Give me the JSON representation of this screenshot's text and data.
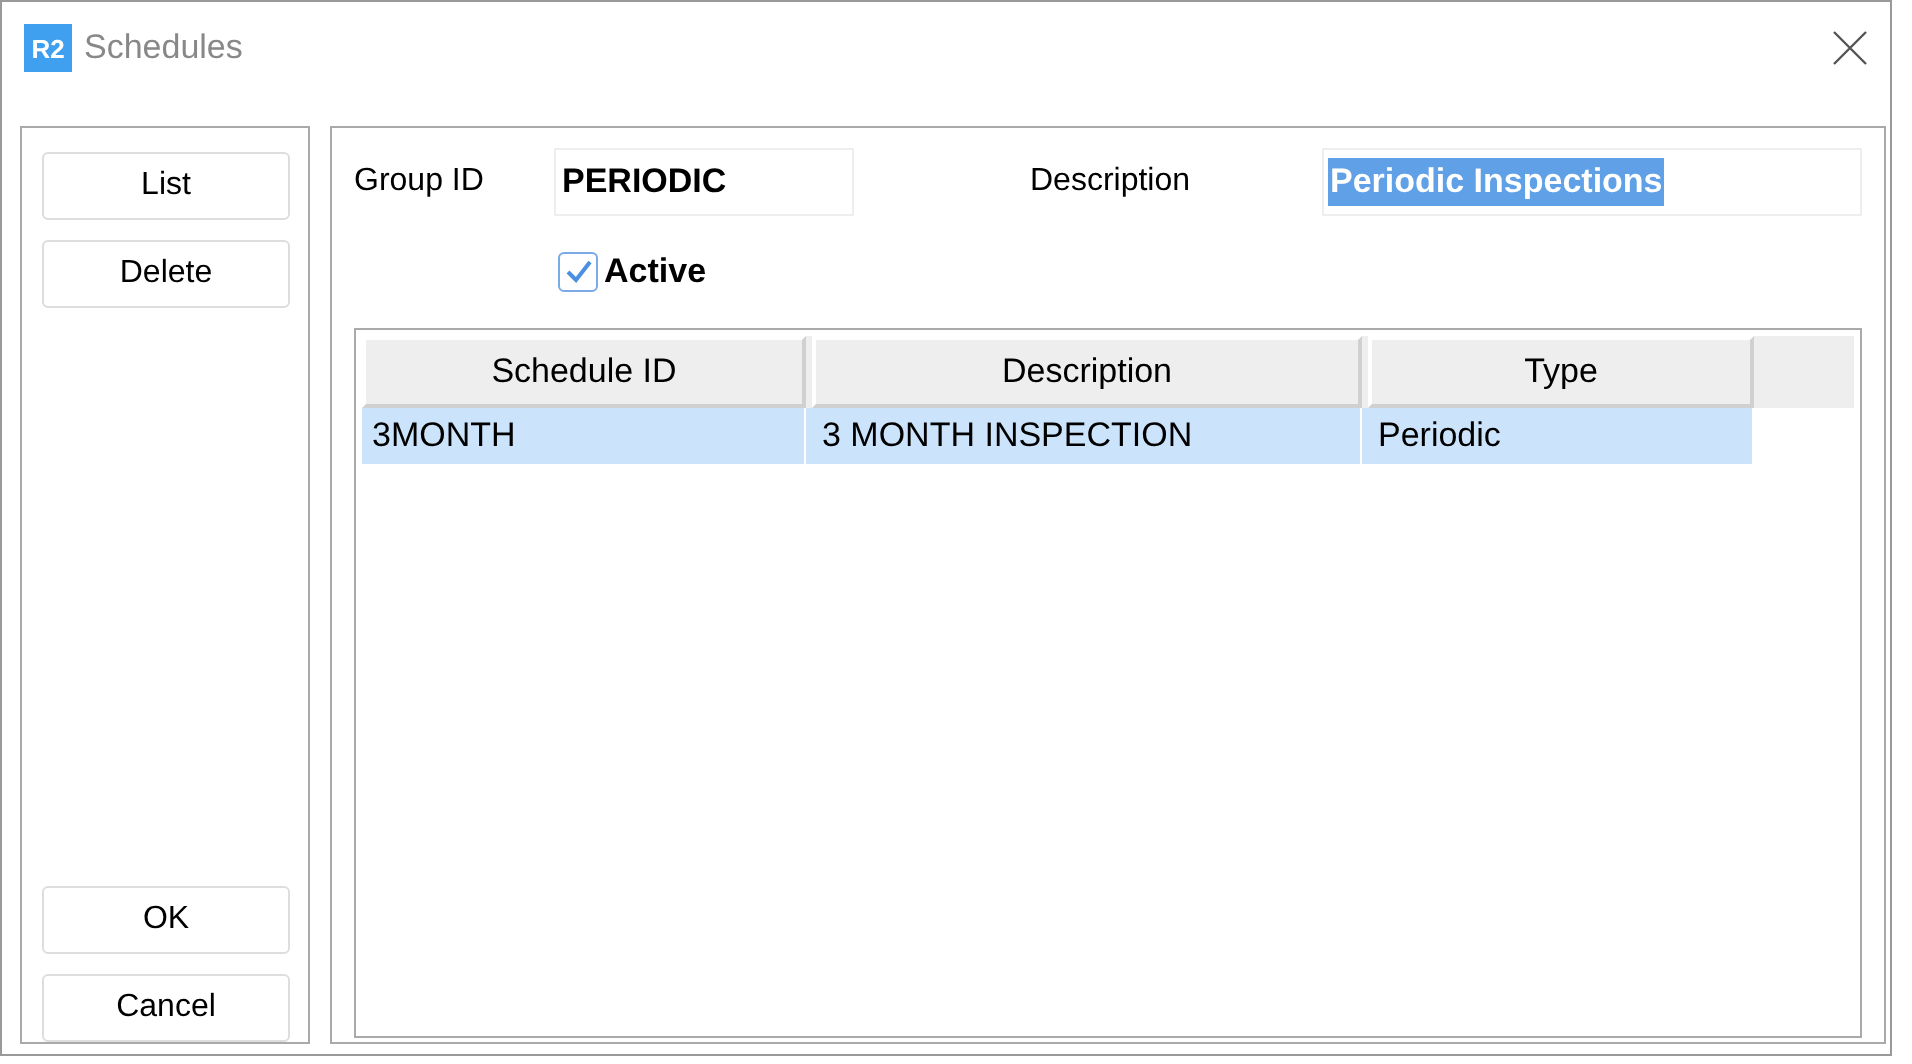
{
  "window": {
    "logo": "R2",
    "title": "Schedules"
  },
  "side_buttons_top": [
    "List",
    "Delete"
  ],
  "side_buttons_bottom": [
    "OK",
    "Cancel"
  ],
  "group_id": {
    "label": "Group ID",
    "value": "PERIODIC"
  },
  "description": {
    "label": "Description",
    "value": "Periodic Inspections",
    "text_selected": true
  },
  "active": {
    "label": "Active",
    "checked": true
  },
  "table": {
    "columns": [
      "Schedule  ID",
      "Description",
      "Type"
    ],
    "rows": [
      {
        "cells": [
          "3MONTH",
          "3 MONTH INSPECTION",
          "Periodic"
        ],
        "selected": true
      }
    ]
  }
}
